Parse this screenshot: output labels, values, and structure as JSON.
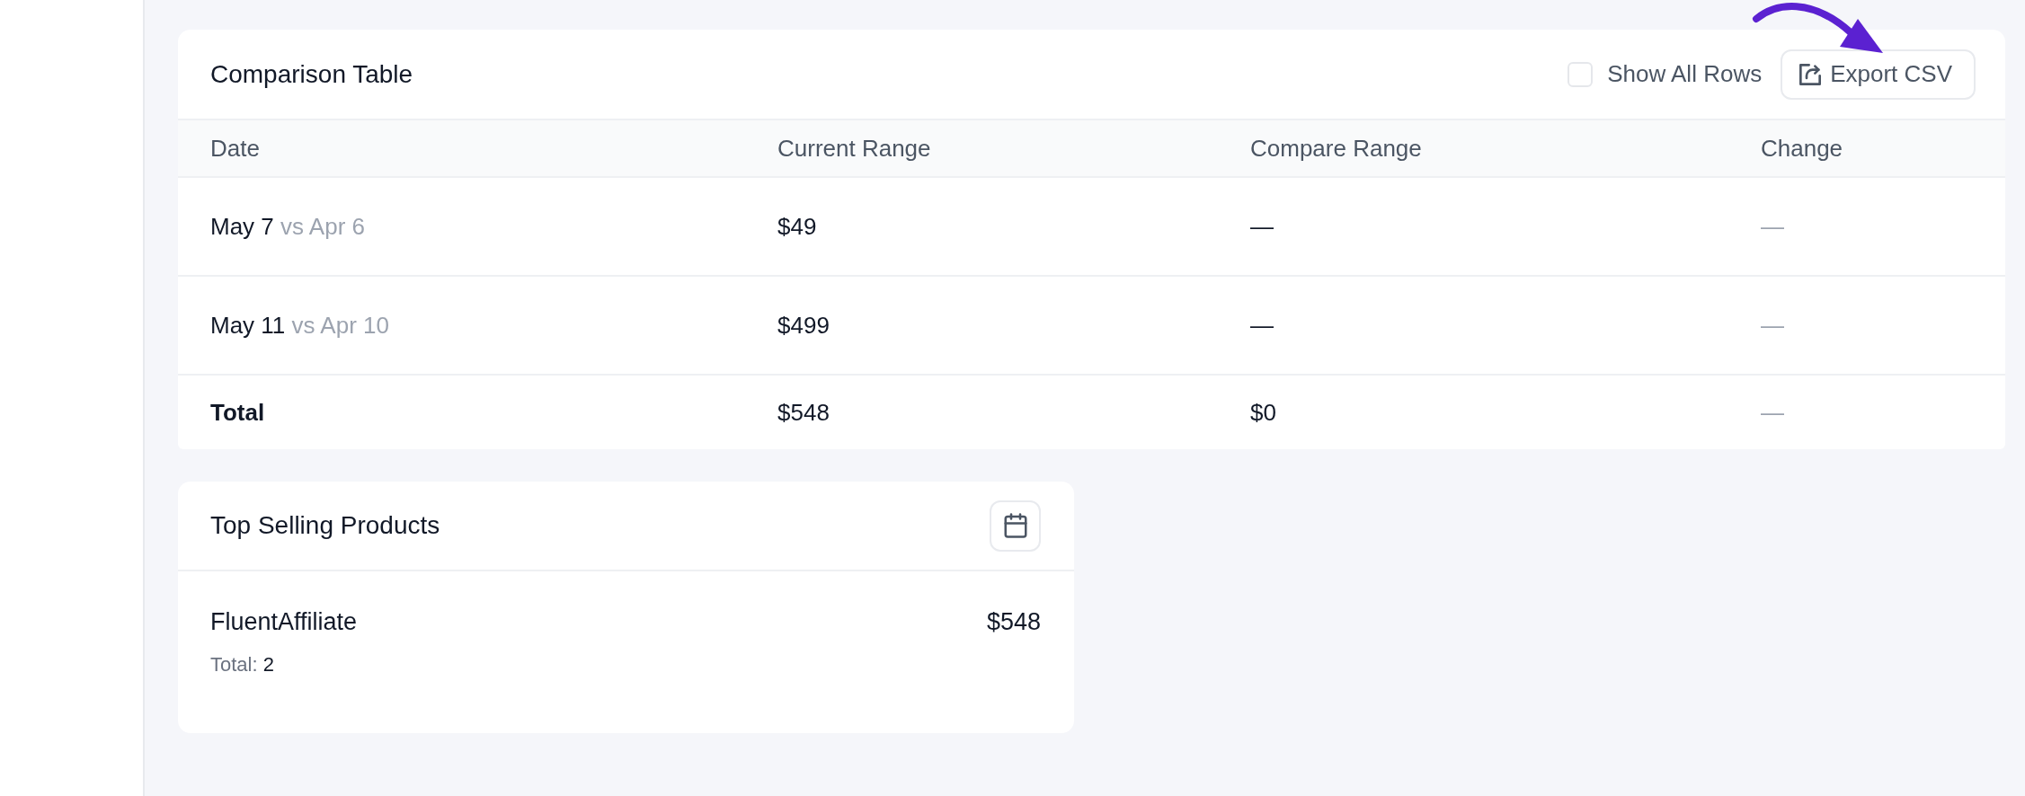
{
  "comparison_table": {
    "title": "Comparison Table",
    "show_all_rows": {
      "label": "Show All Rows",
      "checked": false
    },
    "export_button": {
      "label": "Export CSV"
    },
    "columns": [
      "Date",
      "Current Range",
      "Compare Range",
      "Change"
    ],
    "rows": [
      {
        "date": "May 7",
        "compare_date": "vs Apr 6",
        "current": "$49",
        "compare": "—",
        "change": "—"
      },
      {
        "date": "May 11",
        "compare_date": "vs Apr 10",
        "current": "$499",
        "compare": "—",
        "change": "—"
      }
    ],
    "total": {
      "label": "Total",
      "current": "$548",
      "compare": "$0",
      "change": "—"
    }
  },
  "top_selling_products": {
    "title": "Top Selling Products",
    "products": [
      {
        "name": "FluentAffiliate",
        "amount": "$548",
        "total_label": "Total:",
        "total_value": "2"
      }
    ]
  }
}
